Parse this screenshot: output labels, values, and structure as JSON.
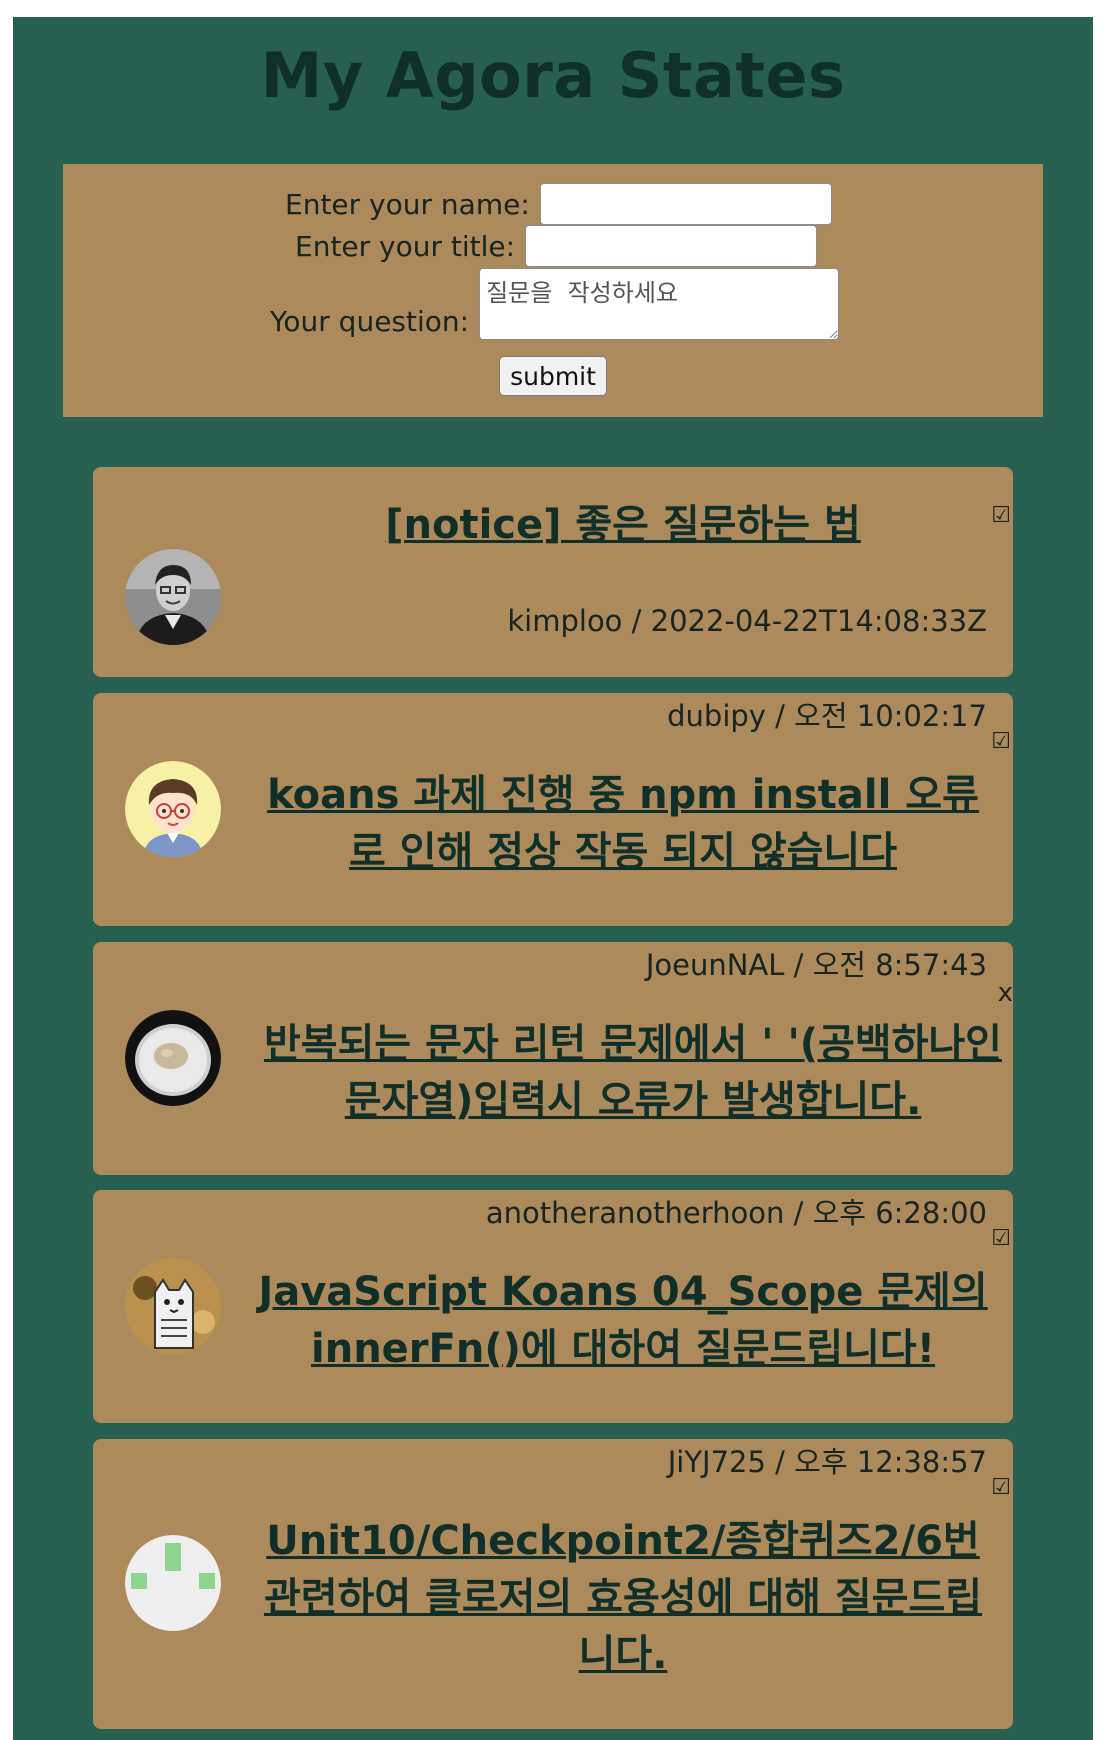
{
  "header": {
    "title": "My Agora States"
  },
  "form": {
    "name_label": "Enter your name:",
    "title_label": "Enter your title:",
    "question_label": "Your question:",
    "name_value": "",
    "title_value": "",
    "question_placeholder": "질문을  작성하세요",
    "submit_label": "submit"
  },
  "discussions": [
    {
      "title": "[notice] 좋은 질문하는 법",
      "info": "kimploo / 2022-04-22T14:08:33Z",
      "answered": "☑",
      "avatar": "person-photo"
    },
    {
      "title": "koans 과제 진행 중 npm install 오류로 인해 정상 작동 되지 않습니다",
      "info": "dubipy / 오전 10:02:17",
      "answered": "☑",
      "avatar": "cartoon-boy"
    },
    {
      "title": "반복되는 문자 리턴 문제에서 ' '(공백하나인 문자열)입력시 오류가 발생합니다.",
      "info": "JoeunNAL / 오전 8:57:43",
      "answered": "x",
      "avatar": "plate-photo"
    },
    {
      "title": "JavaScript Koans 04_Scope 문제의 innerFn()에 대하여 질문드립니다!",
      "info": "anotheranotherhoon / 오후 6:28:00",
      "answered": "☑",
      "avatar": "cat-drawing"
    },
    {
      "title": "Unit10/Checkpoint2/종합퀴즈2/6번 관련하여 클로저의 효용성에 대해 질문드립니다.",
      "info": "JiYJ725 / 오후 12:38:57",
      "answered": "☑",
      "avatar": "identicon"
    }
  ],
  "colors": {
    "page_background": "#276050",
    "card_background": "#ad8a5c",
    "title_text": "#0f2f28"
  }
}
